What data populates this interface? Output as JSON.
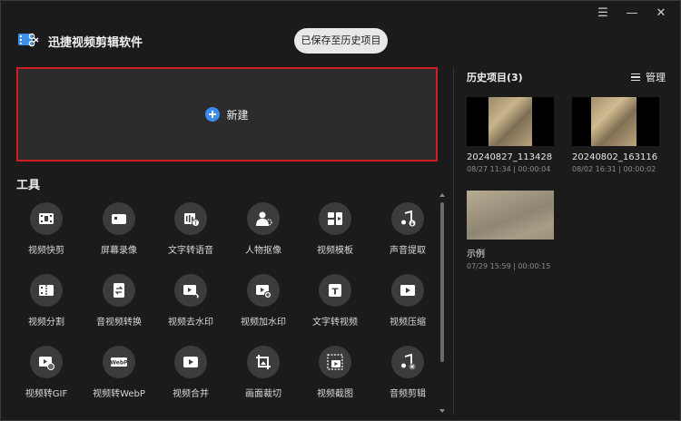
{
  "app": {
    "title": "迅捷视频剪辑软件",
    "logo_icon": "film-scissors-icon",
    "save_status": "已保存至历史项目"
  },
  "window_controls": [
    {
      "name": "menu-icon",
      "glyph": "☰"
    },
    {
      "name": "minimize-icon",
      "glyph": "—"
    },
    {
      "name": "close-icon",
      "glyph": "✕"
    }
  ],
  "new_project": {
    "label": "新建",
    "icon": "plus-circle-icon",
    "accent": "#3a8cf0",
    "highlight": "#d01f24"
  },
  "tools": {
    "title": "工具",
    "items": [
      {
        "label": "视频快剪",
        "icon": "film-icon"
      },
      {
        "label": "屏幕录像",
        "icon": "camera-record-icon"
      },
      {
        "label": "文字转语音",
        "icon": "text-to-speech-icon"
      },
      {
        "label": "人物抠像",
        "icon": "person-cutout-icon"
      },
      {
        "label": "视频模板",
        "icon": "template-icon"
      },
      {
        "label": "声音提取",
        "icon": "music-extract-icon"
      },
      {
        "label": "视频分割",
        "icon": "video-split-icon"
      },
      {
        "label": "音视频转换",
        "icon": "convert-icon"
      },
      {
        "label": "视频去水印",
        "icon": "remove-watermark-icon"
      },
      {
        "label": "视频加水印",
        "icon": "add-watermark-icon"
      },
      {
        "label": "文字转视频",
        "icon": "text-to-video-icon"
      },
      {
        "label": "视频压缩",
        "icon": "compress-icon"
      },
      {
        "label": "视频转GIF",
        "icon": "gif-icon"
      },
      {
        "label": "视频转WebP",
        "icon": "webp-icon"
      },
      {
        "label": "视频合并",
        "icon": "merge-icon"
      },
      {
        "label": "画面裁切",
        "icon": "crop-icon"
      },
      {
        "label": "视频截图",
        "icon": "screenshot-icon"
      },
      {
        "label": "音频剪辑",
        "icon": "audio-edit-icon"
      }
    ]
  },
  "history": {
    "title": "历史项目(3)",
    "manage_label": "管理",
    "items": [
      {
        "name": "20240827_113428",
        "meta": "08/27 11:34 | 00:00:04"
      },
      {
        "name": "20240802_163116",
        "meta": "08/02 16:31 | 00:00:02"
      },
      {
        "name": "示例",
        "meta": "07/29 15:59 | 00:00:15"
      }
    ]
  }
}
